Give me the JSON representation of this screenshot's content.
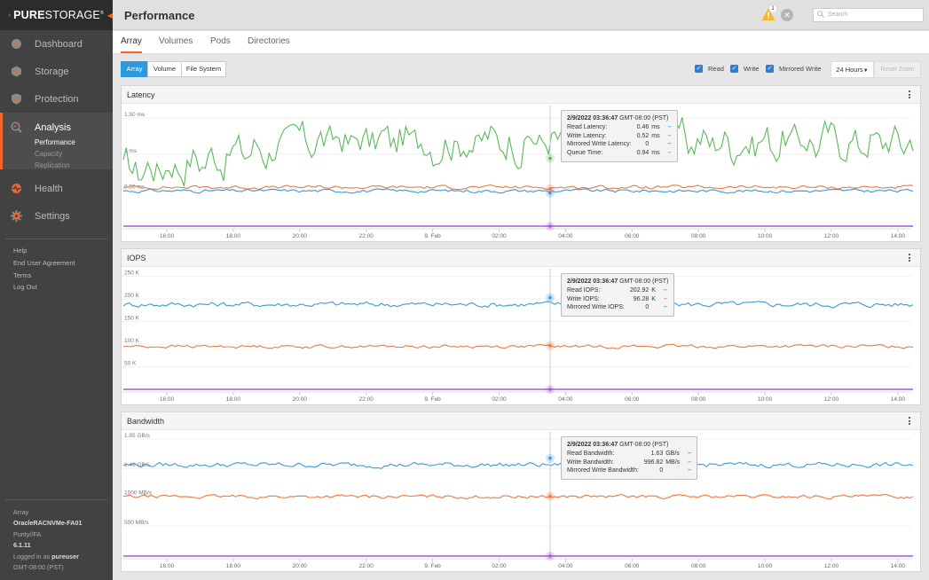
{
  "brand": {
    "name_bold": "PURE",
    "name_rest": "STORAGE",
    "tm": "®"
  },
  "sidebar": {
    "items": [
      {
        "label": "Dashboard",
        "icon": "dashboard-icon"
      },
      {
        "label": "Storage",
        "icon": "storage-icon"
      },
      {
        "label": "Protection",
        "icon": "protection-shield-icon"
      },
      {
        "label": "Analysis",
        "icon": "analysis-magnifier-icon",
        "active": true,
        "subitems": [
          {
            "label": "Performance",
            "active": true
          },
          {
            "label": "Capacity"
          },
          {
            "label": "Replication"
          }
        ]
      },
      {
        "label": "Health",
        "icon": "health-icon"
      },
      {
        "label": "Settings",
        "icon": "settings-gear-icon"
      }
    ],
    "links": [
      "Help",
      "End User Agreement",
      "Terms",
      "Log Out"
    ],
    "sysinfo": {
      "array_label": "Array",
      "array_name": "OracleRACNVMe-FA01",
      "purity_label": "Purity//FA",
      "purity_version": "6.1.11",
      "logged_in_prefix": "Logged in as",
      "user": "pureuser",
      "timezone": "GMT-08:00 (PST)"
    }
  },
  "header": {
    "title": "Performance",
    "alert_count": "1",
    "search_placeholder": "Search"
  },
  "tabs": [
    "Array",
    "Volumes",
    "Pods",
    "Directories"
  ],
  "active_tab": "Array",
  "scope_buttons": [
    "Array",
    "Volume",
    "File System"
  ],
  "active_scope": "Array",
  "filters": [
    {
      "label": "Read",
      "checked": true
    },
    {
      "label": "Write",
      "checked": true
    },
    {
      "label": "Mirrored Write",
      "checked": true
    }
  ],
  "time_range": "24 Hours",
  "reset_zoom": "Reset Zoom",
  "colors": {
    "read": "#3a9ad9",
    "write": "#ec7a45",
    "mirrored": "#a259d9",
    "queue": "#5cb85c",
    "accent": "#f4642c"
  },
  "chart_data": [
    {
      "type": "line",
      "title": "Latency",
      "x_ticks": [
        "16:00",
        "18:00",
        "20:00",
        "22:00",
        "9. Feb",
        "02:00",
        "04:00",
        "06:00",
        "08:00",
        "10:00",
        "12:00",
        "14:00"
      ],
      "y_ticks": [
        "0.50 ms",
        "1 ms",
        "1.50 ms"
      ],
      "y_tick_values": [
        0.5,
        1.0,
        1.5
      ],
      "ylim": [
        0,
        1.6
      ],
      "series": [
        {
          "name": "Queue Time",
          "color": "queue",
          "base": 1.18,
          "amp": 0.22,
          "start": 0.75,
          "rise": true
        },
        {
          "name": "Write Latency",
          "color": "write",
          "base": 0.54,
          "amp": 0.02
        },
        {
          "name": "Read Latency",
          "color": "read",
          "base": 0.49,
          "amp": 0.02
        },
        {
          "name": "Mirrored Write Latency",
          "color": "mirrored",
          "base": 0.0,
          "amp": 0
        }
      ],
      "cursor_x": "03:36:47",
      "tooltip": {
        "date": "2/9/2022 03:36:47",
        "tz": "GMT-08:00 (PST)",
        "rows": [
          {
            "label": "Read Latency:",
            "value": "0.46",
            "unit": "ms",
            "color": "read"
          },
          {
            "label": "Write Latency:",
            "value": "0.52",
            "unit": "ms",
            "color": "write"
          },
          {
            "label": "Mirrored Write Latency:",
            "value": "0",
            "unit": "",
            "color": "mirrored"
          },
          {
            "label": "Queue Time:",
            "value": "0.94",
            "unit": "ms",
            "color": "queue"
          }
        ]
      }
    },
    {
      "type": "line",
      "title": "IOPS",
      "x_ticks": [
        "16:00",
        "18:00",
        "20:00",
        "22:00",
        "9. Feb",
        "02:00",
        "04:00",
        "06:00",
        "08:00",
        "10:00",
        "12:00",
        "14:00"
      ],
      "y_ticks": [
        "50 K",
        "100 K",
        "150 K",
        "200 K",
        "250 K"
      ],
      "y_tick_values": [
        50,
        100,
        150,
        200,
        250
      ],
      "ylim": [
        0,
        255
      ],
      "series": [
        {
          "name": "Read IOPS",
          "color": "read",
          "base": 188,
          "amp": 5
        },
        {
          "name": "Write IOPS",
          "color": "write",
          "base": 95,
          "amp": 3
        },
        {
          "name": "Mirrored Write IOPS",
          "color": "mirrored",
          "base": 0,
          "amp": 0
        }
      ],
      "cursor_x": "03:36:47",
      "tooltip": {
        "date": "2/9/2022 03:36:47",
        "tz": "GMT-08:00 (PST)",
        "rows": [
          {
            "label": "Read IOPS:",
            "value": "202.92",
            "unit": "K",
            "color": "read"
          },
          {
            "label": "Write IOPS:",
            "value": "96.28",
            "unit": "K",
            "color": "write"
          },
          {
            "label": "Mirrored Write IOPS:",
            "value": "0",
            "unit": "",
            "color": "mirrored"
          }
        ]
      }
    },
    {
      "type": "line",
      "title": "Bandwidth",
      "x_ticks": [
        "16:00",
        "18:00",
        "20:00",
        "22:00",
        "9. Feb",
        "02:00",
        "04:00",
        "06:00",
        "08:00",
        "10:00",
        "12:00",
        "14:00"
      ],
      "y_ticks": [
        "500 MB/s",
        "1000 MB/s",
        "1.46 GB/s",
        "1.95 GB/s"
      ],
      "y_tick_values": [
        500,
        1000,
        1460,
        1950
      ],
      "ylim": [
        0,
        1980
      ],
      "series": [
        {
          "name": "Read Bandwidth",
          "color": "read",
          "base": 1520,
          "amp": 35
        },
        {
          "name": "Write Bandwidth",
          "color": "write",
          "base": 990,
          "amp": 25
        },
        {
          "name": "Mirrored Write Bandwidth",
          "color": "mirrored",
          "base": 0,
          "amp": 0
        }
      ],
      "cursor_x": "03:36:47",
      "tooltip": {
        "date": "2/9/2022 03:36:47",
        "tz": "GMT-08:00 (PST)",
        "rows": [
          {
            "label": "Read Bandwidth:",
            "value": "1.63",
            "unit": "GB/s",
            "color": "read"
          },
          {
            "label": "Write Bandwidth:",
            "value": "996.82",
            "unit": "MB/s",
            "color": "write"
          },
          {
            "label": "Mirrored Write Bandwidth:",
            "value": "0",
            "unit": "",
            "color": "mirrored"
          }
        ]
      }
    }
  ]
}
